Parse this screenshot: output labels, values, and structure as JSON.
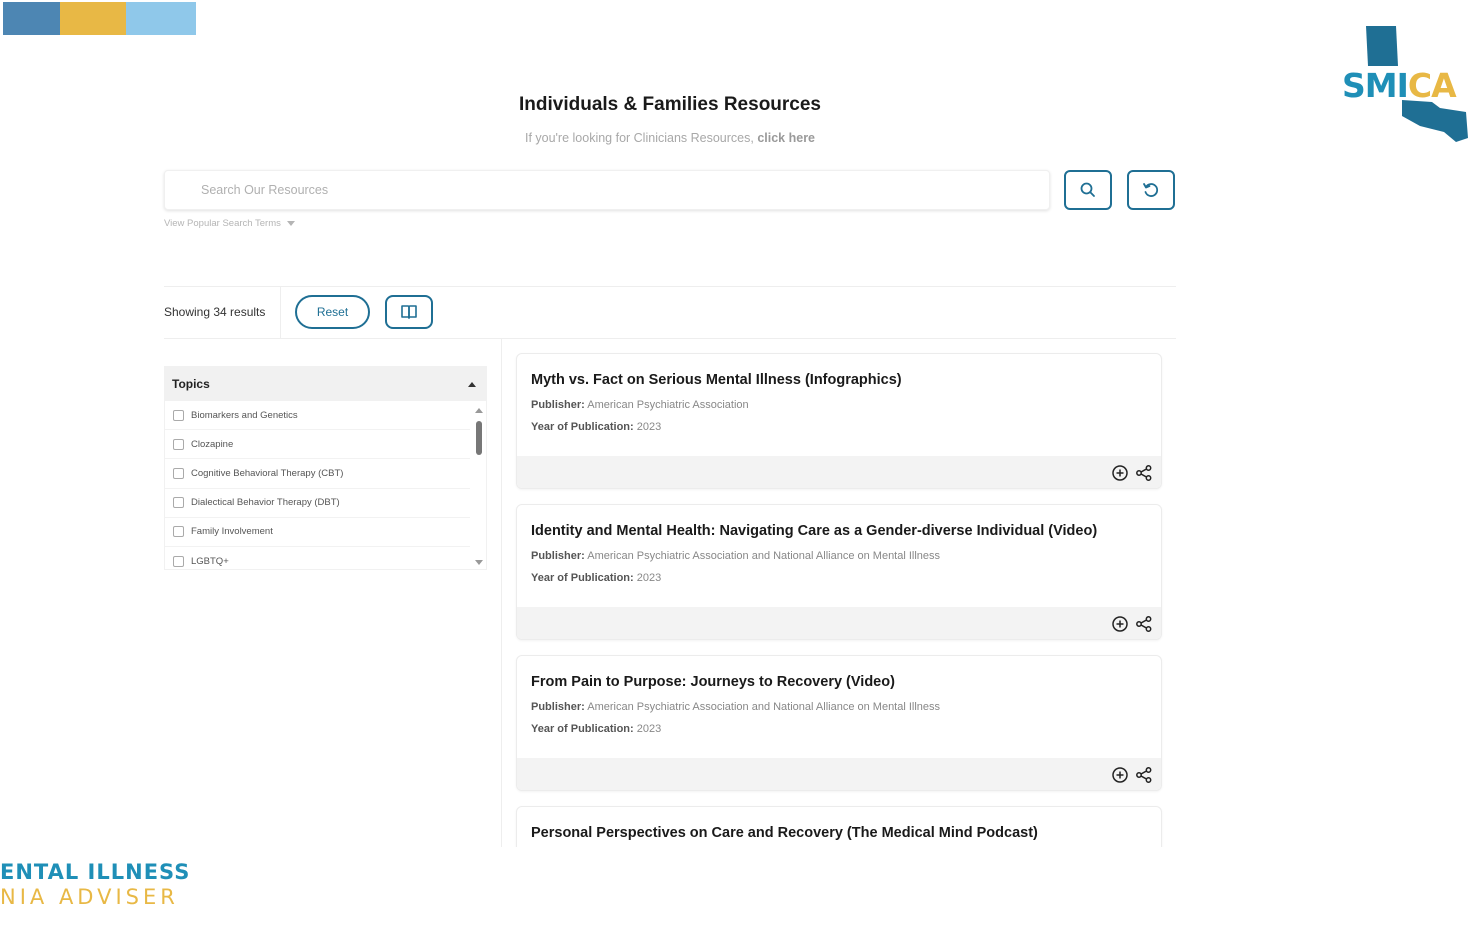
{
  "brand": {
    "strip_colors": [
      "#4d86b3",
      "#e8b845",
      "#8fc8ea"
    ],
    "logo_part1": "SMI",
    "logo_part2": "CA",
    "footer_line1": "ENTAL ILLNESS",
    "footer_line2": "NIA ADVISER"
  },
  "header": {
    "title": "Individuals & Families Resources",
    "subtitle_prefix": "If you're looking for Clinicians Resources, ",
    "subtitle_link": "click here"
  },
  "search": {
    "placeholder": "Search Our Resources",
    "popular_terms": "View Popular Search Terms"
  },
  "results_bar": {
    "showing_text": "Showing 34 results",
    "reset_label": "Reset"
  },
  "topics": {
    "header": "Topics",
    "items": [
      "Biomarkers and Genetics",
      "Clozapine",
      "Cognitive Behavioral Therapy (CBT)",
      "Dialectical Behavior Therapy (DBT)",
      "Family Involvement",
      "LGBTQ+"
    ]
  },
  "resources": [
    {
      "title": "Myth vs. Fact on Serious Mental Illness (Infographics)",
      "publisher_label": "Publisher:",
      "publisher": "American Psychiatric Association",
      "year_label": "Year of Publication:",
      "year": "2023"
    },
    {
      "title": "Identity and Mental Health: Navigating Care as a Gender-diverse Individual (Video)",
      "publisher_label": "Publisher:",
      "publisher": "American Psychiatric Association and National Alliance on Mental Illness",
      "year_label": "Year of Publication:",
      "year": "2023"
    },
    {
      "title": "From Pain to Purpose: Journeys to Recovery (Video)",
      "publisher_label": "Publisher:",
      "publisher": "American Psychiatric Association and National Alliance on Mental Illness",
      "year_label": "Year of Publication:",
      "year": "2023"
    },
    {
      "title": "Personal Perspectives on Care and Recovery (The Medical Mind Podcast)"
    }
  ],
  "colors": {
    "accent": "#1f6f94",
    "brand_blue": "#1f8fb7",
    "brand_gold": "#e8b845"
  },
  "icons": {
    "search": "magnifier-icon",
    "refresh": "refresh-icon",
    "book": "book-icon",
    "add": "plus-circle-icon",
    "share": "share-icon"
  }
}
